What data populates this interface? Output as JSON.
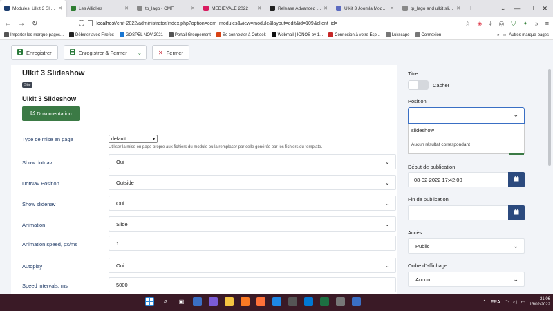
{
  "browser": {
    "tabs": [
      {
        "label": "Modules: Ulkit 3 Slideshow",
        "color": "#1c3d6e",
        "active": true
      },
      {
        "label": "Les Alliolles",
        "color": "#2e7d32",
        "active": false
      },
      {
        "label": "tp_lago - CMF",
        "color": "#888888",
        "active": false
      },
      {
        "label": "MEDIEVALE 2022",
        "color": "#d81b60",
        "active": false
      },
      {
        "label": "Release Advanced Custom...",
        "color": "#222222",
        "active": false
      },
      {
        "label": "Ulkit 3 Joomla Module ...",
        "color": "#5c6bc0",
        "active": false
      },
      {
        "label": "tp_lago and ulkit slideshow",
        "color": "#888888",
        "active": false
      }
    ],
    "new_tab": "+",
    "url_host": "localhost",
    "url_rest": "/cmf-2022/administrator/index.php?option=com_modules&view=module&layout=edit&id=109&client_id=",
    "bookmarks": [
      {
        "label": "Importer les marque-pages...",
        "color": "#555555"
      },
      {
        "label": "Débuter avec Firefox",
        "color": "#222222"
      },
      {
        "label": "GOSPEL NOV 2021",
        "color": "#1976d2"
      },
      {
        "label": "Portail Groupement",
        "color": "#555555"
      },
      {
        "label": "Se connecter à Outlook",
        "color": "#d84315"
      },
      {
        "label": "Webmail | IONOS by 1...",
        "color": "#111111"
      },
      {
        "label": "Connexion à votre Esp...",
        "color": "#c62828"
      },
      {
        "label": "Lukscape",
        "color": "#777777"
      },
      {
        "label": "Connexion",
        "color": "#777777"
      }
    ],
    "bookmarks_other": "Autres marque-pages"
  },
  "toolbar": {
    "save": "Enregistrer",
    "save_close": "Enregistrer & Fermer",
    "close": "Fermer"
  },
  "module": {
    "title": "UIkit 3 Slideshow",
    "badge": "Site",
    "subtitle": "UIkit 3 Slideshow",
    "doc_button": "Dokumentation"
  },
  "form": {
    "layout_label": "Type de mise en page",
    "layout_value": "default",
    "layout_help": "Utiliser la mise en page propre aux fichiers du module ou la remplacer par celle générée par les fichiers du template.",
    "fields": [
      {
        "label": "Show dotnav",
        "value": "Oui",
        "kind": "select"
      },
      {
        "label": "DotNav Position",
        "value": "Outside",
        "kind": "select"
      },
      {
        "label": "Show slidenav",
        "value": "Oui",
        "kind": "select"
      },
      {
        "label": "Animation",
        "value": "Slide",
        "kind": "select"
      },
      {
        "label": "Animation speed, px/ms",
        "value": "1",
        "kind": "input"
      },
      {
        "label": "Autoplay",
        "value": "Oui",
        "kind": "select"
      },
      {
        "label": "Speed intervals, ms",
        "value": "5000",
        "kind": "input"
      }
    ]
  },
  "sidebar": {
    "title_label": "Titre",
    "hide_label": "Cacher",
    "position_label": "Position",
    "position_search": "slideshow",
    "position_no_result": "Aucun résultat correspondant",
    "publish_start_label": "Début de publication",
    "publish_start_value": "08-02-2022 17:42:00",
    "publish_end_label": "Fin de publication",
    "publish_end_value": "",
    "access_label": "Accès",
    "access_value": "Public",
    "order_label": "Ordre d'affichage",
    "order_value": "Aucun"
  },
  "taskbar": {
    "time": "21:06",
    "date": "13/02/2022",
    "lang": "FRA",
    "icons": [
      {
        "name": "windows-icon",
        "color": "#2b88d8"
      },
      {
        "name": "search-icon",
        "color": "transparent"
      },
      {
        "name": "task-view-icon",
        "color": "transparent"
      },
      {
        "name": "widgets-icon",
        "color": "#3a6fc4"
      },
      {
        "name": "teams-icon",
        "color": "#7b5cd6"
      },
      {
        "name": "file-explorer-icon",
        "color": "#f5c542"
      },
      {
        "name": "xampp-icon",
        "color": "#fb7a24"
      },
      {
        "name": "firefox-icon",
        "color": "#ff7139"
      },
      {
        "name": "edge-icon",
        "color": "#1e88e5"
      },
      {
        "name": "photos-icon",
        "color": "#555555"
      },
      {
        "name": "skype-icon",
        "color": "#0078d4"
      },
      {
        "name": "excel-icon",
        "color": "#1d6f42"
      },
      {
        "name": "app-icon",
        "color": "#777777"
      },
      {
        "name": "store-icon",
        "color": "#3a6fc4"
      }
    ]
  },
  "colors": {
    "accent_green": "#3b7a45",
    "accent_blue": "#2c4a7e",
    "label_blue": "#1f3a66",
    "danger": "#c82333"
  }
}
